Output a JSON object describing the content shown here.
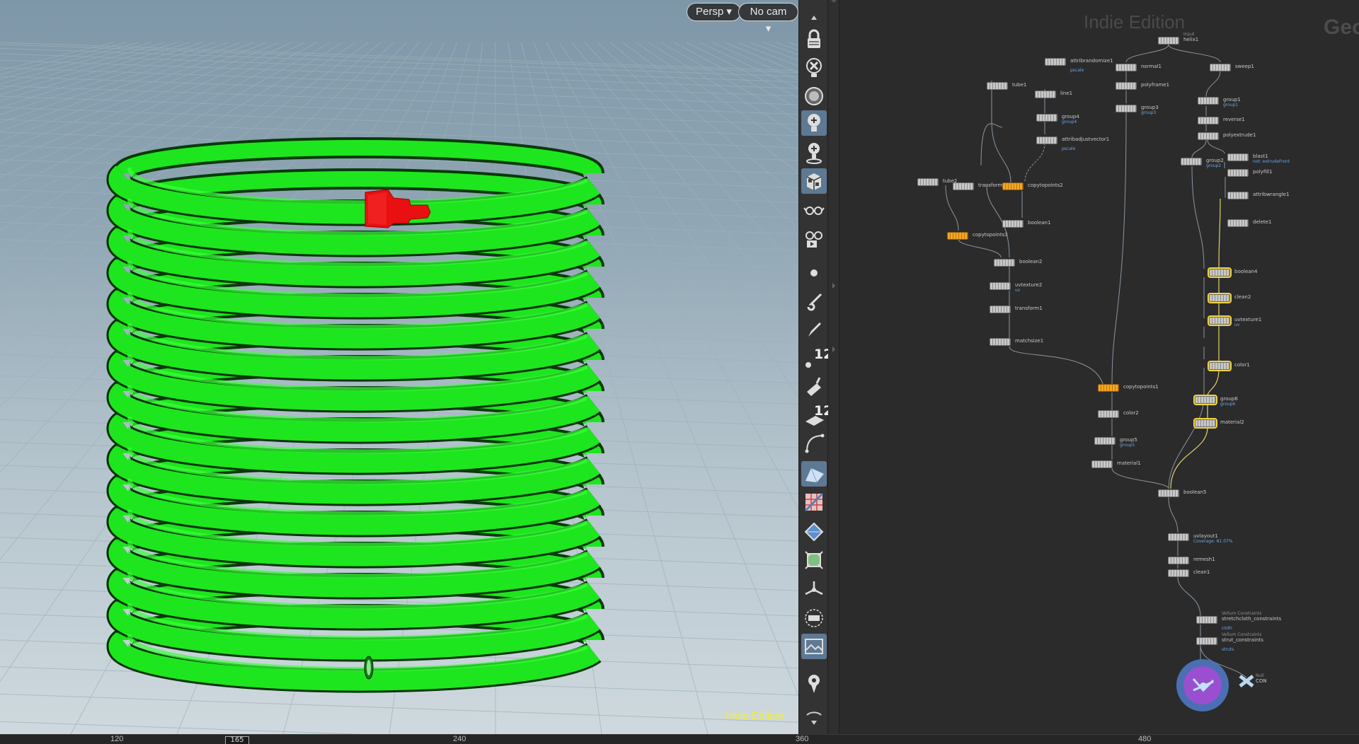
{
  "viewport": {
    "camera_label": "Persp",
    "cam_label": "No cam",
    "watermark": "Indie Edition",
    "colors": {
      "coil": "#1ee61e",
      "coil_dark": "#0e8f0e",
      "object": "#e81010"
    }
  },
  "toolbar": {
    "icons": [
      "scroll-up-icon",
      "lock-icon",
      "ghost-other-objects-icon",
      "template-icon",
      "light-icon",
      "headlight-icon",
      "display-options-icon",
      "background-icon",
      "stereo-icon",
      "vr-icon",
      "point-icon",
      "brush-icon",
      "pen-icon",
      "display-points-icon",
      "wire-icon",
      "normals-icon",
      "curve-icon",
      "shaded-icon",
      "texture-icon",
      "safe-area-icon",
      "uv-icon",
      "transform-icon",
      "snap-icon",
      "render-region-icon",
      "image-icon",
      "pin-icon",
      "scroll-down-icon"
    ],
    "num1": "12",
    "num2": "12"
  },
  "network": {
    "watermark": "Indie Edition",
    "context": "Geo",
    "nodes": [
      {
        "id": "helix1",
        "name": "helix1",
        "sup": "Input"
      },
      {
        "id": "attribrandomize1",
        "name": "attribrandomize1",
        "sub": "pscale"
      },
      {
        "id": "normal1",
        "name": "normal1"
      },
      {
        "id": "sweep1",
        "name": "sweep1"
      },
      {
        "id": "tube1",
        "name": "tube1"
      },
      {
        "id": "line1",
        "name": "line1"
      },
      {
        "id": "polyframe1",
        "name": "polyframe1"
      },
      {
        "id": "group4",
        "name": "group4",
        "sub": "group4"
      },
      {
        "id": "group3",
        "name": "group3",
        "sub": "group3"
      },
      {
        "id": "group1",
        "name": "group1",
        "sub": "group1"
      },
      {
        "id": "reverse1",
        "name": "reverse1"
      },
      {
        "id": "attribadjustvector1",
        "name": "attribadjustvector1",
        "sub": "pscale"
      },
      {
        "id": "polyextrude1",
        "name": "polyextrude1"
      },
      {
        "id": "blast1",
        "name": "blast1",
        "sub": "not: extrudeFront"
      },
      {
        "id": "group2",
        "name": "group2",
        "sub": "group2"
      },
      {
        "id": "polyfill1",
        "name": "polyfill1"
      },
      {
        "id": "tube2",
        "name": "tube2"
      },
      {
        "id": "transform2",
        "name": "transform2"
      },
      {
        "id": "copytopoints2",
        "name": "copytopoints2"
      },
      {
        "id": "attribwrangle1",
        "name": "attribwrangle1"
      },
      {
        "id": "boolean1",
        "name": "boolean1"
      },
      {
        "id": "delete1",
        "name": "delete1"
      },
      {
        "id": "copytopoints3",
        "name": "copytopoints3"
      },
      {
        "id": "boolean2",
        "name": "boolean2"
      },
      {
        "id": "boolean4",
        "name": "boolean4"
      },
      {
        "id": "uvtexture2",
        "name": "uvtexture2",
        "sub": "uv"
      },
      {
        "id": "clean2",
        "name": "clean2"
      },
      {
        "id": "transform1",
        "name": "transform1"
      },
      {
        "id": "uvtexture1",
        "name": "uvtexture1",
        "sub": "uv"
      },
      {
        "id": "matchsize1",
        "name": "matchsize1"
      },
      {
        "id": "color1",
        "name": "color1"
      },
      {
        "id": "copytopoints1",
        "name": "copytopoints1"
      },
      {
        "id": "group6",
        "name": "group6",
        "sub": "group6"
      },
      {
        "id": "color2",
        "name": "color2"
      },
      {
        "id": "material2",
        "name": "material2"
      },
      {
        "id": "group5",
        "name": "group5",
        "sub": "group5"
      },
      {
        "id": "material1",
        "name": "material1"
      },
      {
        "id": "boolean5",
        "name": "boolean5"
      },
      {
        "id": "uvlayout1",
        "name": "uvlayout1",
        "sub": "Coverage: 81.07%"
      },
      {
        "id": "remesh1",
        "name": "remesh1"
      },
      {
        "id": "clean1",
        "name": "clean1"
      },
      {
        "id": "stretchcloth_constraints",
        "name": "stretchcloth_constraints",
        "sup": "Vellum Constraints",
        "sub": "cloth"
      },
      {
        "id": "strut_constraints",
        "name": "strut_constraints",
        "sup": "Vellum Constraints",
        "sub": "struts"
      },
      {
        "id": "out_con",
        "name": "CON",
        "sup": "Null"
      }
    ]
  },
  "timeline": {
    "ticks": [
      "120",
      "240",
      "360",
      "480"
    ],
    "current_frame": "165"
  }
}
